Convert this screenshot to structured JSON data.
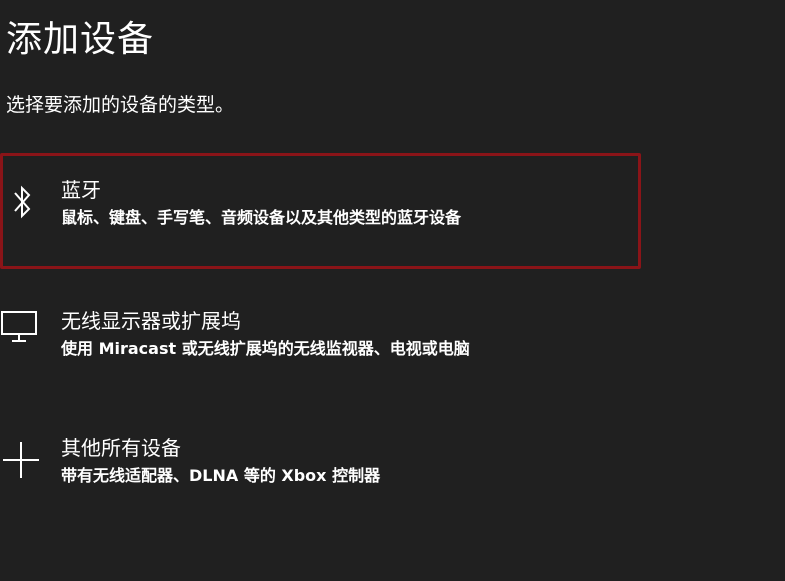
{
  "dialog": {
    "title": "添加设备",
    "subtitle": "选择要添加的设备的类型。"
  },
  "options": [
    {
      "title": "蓝牙",
      "description": "鼠标、键盘、手写笔、音频设备以及其他类型的蓝牙设备",
      "icon": "bluetooth-icon",
      "selected": true
    },
    {
      "title": "无线显示器或扩展坞",
      "description": "使用 Miracast 或无线扩展坞的无线监视器、电视或电脑",
      "icon": "monitor-icon",
      "selected": false
    },
    {
      "title": "其他所有设备",
      "description": "带有无线适配器、DLNA 等的 Xbox 控制器",
      "icon": "plus-icon",
      "selected": false
    }
  ],
  "colors": {
    "background": "#202020",
    "text": "#ffffff",
    "selection_border": "#8a1418"
  }
}
